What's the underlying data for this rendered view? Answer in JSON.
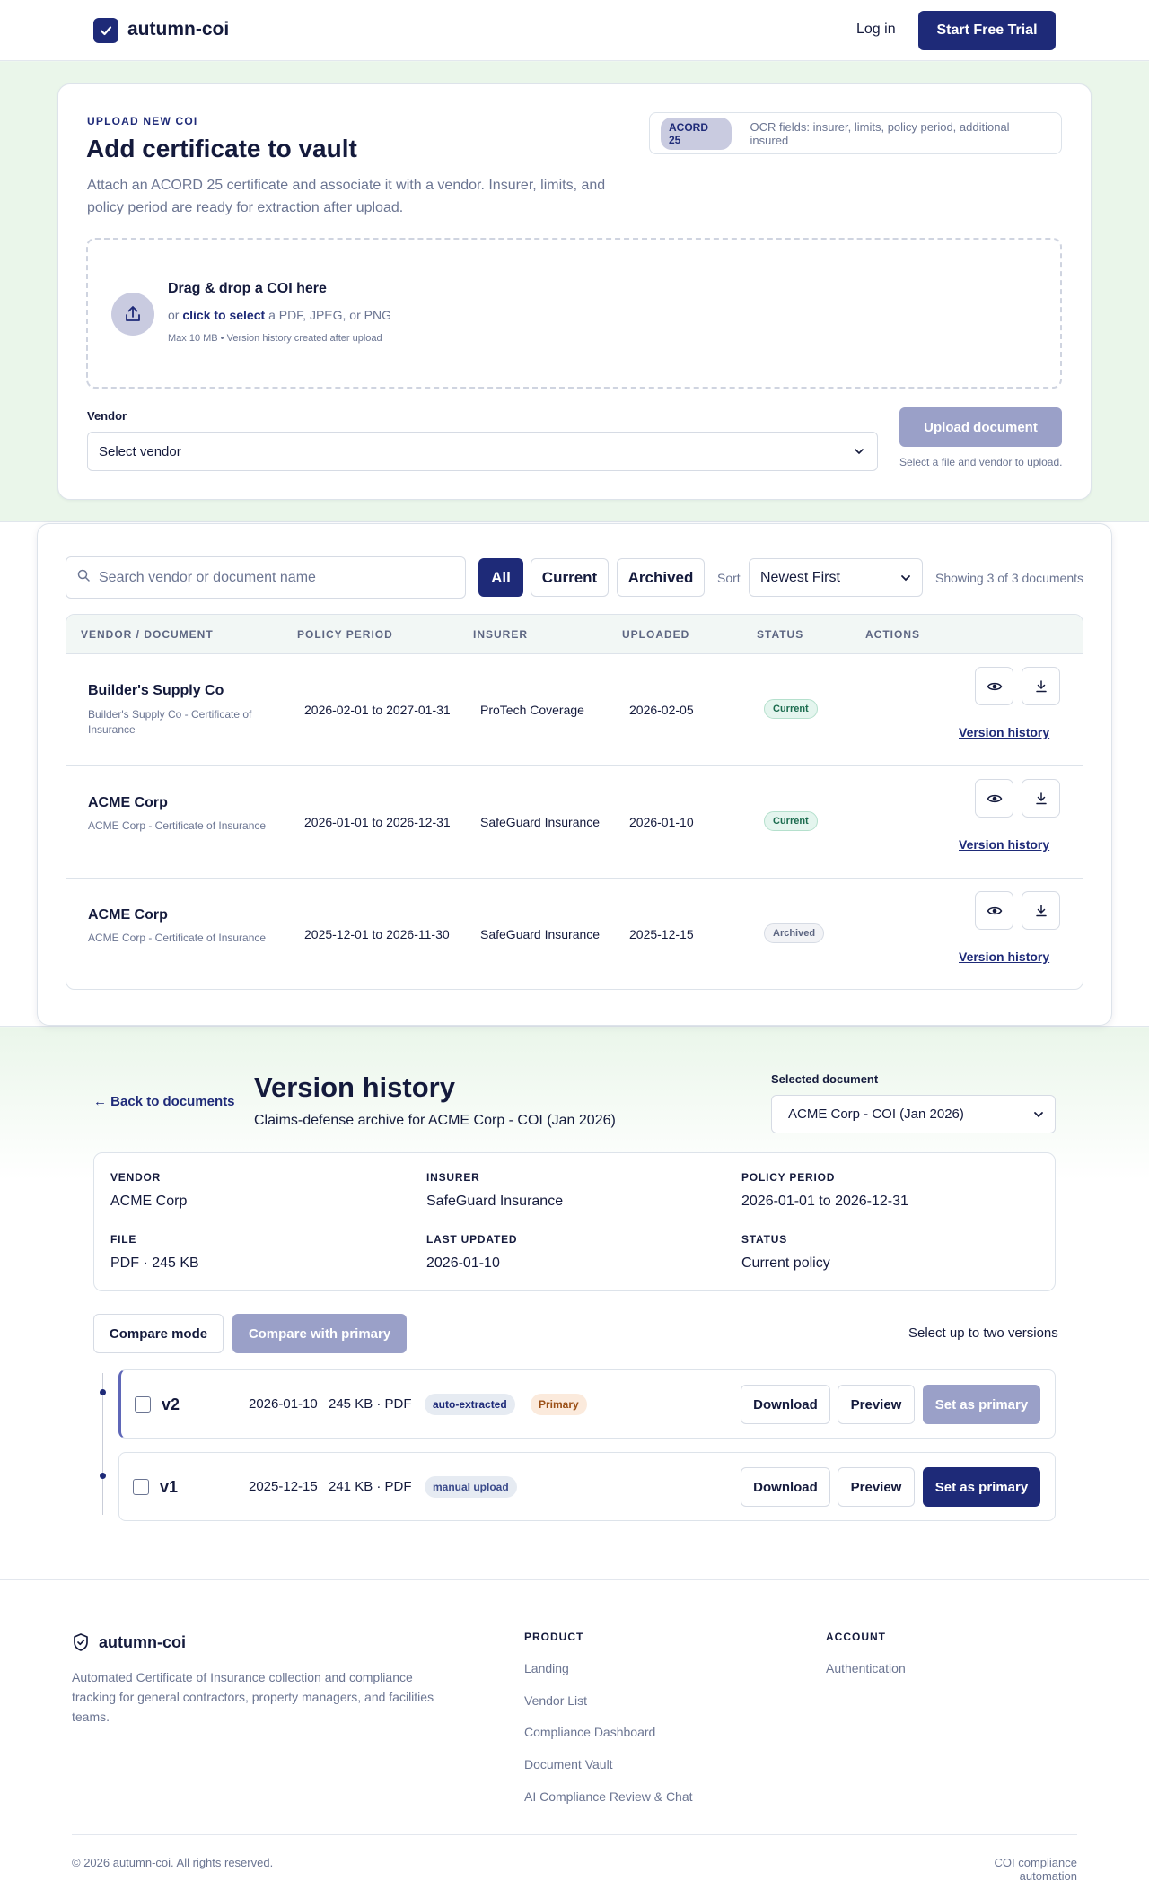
{
  "header": {
    "brand": "autumn-coi",
    "login": "Log in",
    "cta": "Start Free Trial"
  },
  "upload": {
    "eyebrow": "UPLOAD NEW COI",
    "title": "Add certificate to vault",
    "description": "Attach an ACORD 25 certificate and associate it with a vendor. Insurer, limits, and policy period are ready for extraction after upload.",
    "acord_pill": "ACORD 25",
    "acord_text": "OCR fields: insurer, limits, policy period, additional insured",
    "drop_title": "Drag & drop a COI here",
    "drop_or": "or",
    "drop_click": "click to select",
    "drop_rest": "a PDF, JPEG, or PNG",
    "drop_note": "Max 10 MB • Version history created after upload",
    "vendor_label": "Vendor",
    "vendor_select": "Select vendor",
    "upload_button": "Upload document",
    "upload_hint": "Select a file and vendor to upload."
  },
  "documents": {
    "search_placeholder": "Search vendor or document name",
    "filters": [
      "All",
      "Current",
      "Archived"
    ],
    "sort_label": "Sort",
    "sort_value": "Newest First",
    "showing": "Showing 3 of 3 documents",
    "columns": [
      "VENDOR / DOCUMENT",
      "POLICY PERIOD",
      "INSURER",
      "UPLOADED",
      "STATUS",
      "ACTIONS"
    ],
    "rows": [
      {
        "vendor": "Builder's Supply Co",
        "doc": "Builder's Supply Co - Certificate of Insurance",
        "period": "2026-02-01 to 2027-01-31",
        "insurer": "ProTech Coverage",
        "uploaded": "2026-02-05",
        "status": "Current",
        "link": "Version history"
      },
      {
        "vendor": "ACME Corp",
        "doc": "ACME Corp - Certificate of Insurance",
        "period": "2026-01-01 to 2026-12-31",
        "insurer": "SafeGuard Insurance",
        "uploaded": "2026-01-10",
        "status": "Current",
        "link": "Version history"
      },
      {
        "vendor": "ACME Corp",
        "doc": "ACME Corp - Certificate of Insurance",
        "period": "2025-12-01 to 2026-11-30",
        "insurer": "SafeGuard Insurance",
        "uploaded": "2025-12-15",
        "status": "Archived",
        "link": "Version history"
      }
    ]
  },
  "version": {
    "back": "← Back to documents",
    "title": "Version history",
    "subtitle": "Claims-defense archive for ACME Corp - COI (Jan 2026)",
    "selected_label": "Selected document",
    "selected_value": "ACME Corp - COI (Jan 2026)",
    "meta": {
      "vendor_label": "VENDOR",
      "vendor": "ACME Corp",
      "insurer_label": "INSURER",
      "insurer": "SafeGuard Insurance",
      "period_label": "POLICY PERIOD",
      "period": "2026-01-01 to 2026-12-31",
      "file_label": "FILE",
      "file": "PDF · 245 KB",
      "updated_label": "LAST UPDATED",
      "updated": "2026-01-10",
      "status_label": "STATUS",
      "status": "Current policy"
    },
    "compare_mode": "Compare mode",
    "compare_primary": "Compare with primary",
    "select_hint": "Select up to two versions",
    "versions": [
      {
        "name": "v2",
        "date": "2026-01-10",
        "size": "245 KB · PDF",
        "tag": "auto-extracted",
        "primary_tag": "Primary",
        "download": "Download",
        "preview": "Preview",
        "set_primary": "Set as primary"
      },
      {
        "name": "v1",
        "date": "2025-12-15",
        "size": "241 KB · PDF",
        "tag": "manual upload",
        "download": "Download",
        "preview": "Preview",
        "set_primary": "Set as primary"
      }
    ]
  },
  "footer": {
    "brand": "autumn-coi",
    "description": "Automated Certificate of Insurance collection and compliance tracking for general contractors, property managers, and facilities teams.",
    "product_head": "PRODUCT",
    "product_links": [
      "Landing",
      "Vendor List",
      "Compliance Dashboard",
      "Document Vault",
      "AI Compliance Review & Chat"
    ],
    "account_head": "ACCOUNT",
    "account_links": [
      "Authentication"
    ],
    "copyright": "© 2026 autumn-coi. All rights reserved.",
    "tagline": "COI compliance automation"
  },
  "colors": {
    "brand": "#1e2a78",
    "page_bg": "#eaf6ea",
    "disabled": "#9aa0c8"
  }
}
